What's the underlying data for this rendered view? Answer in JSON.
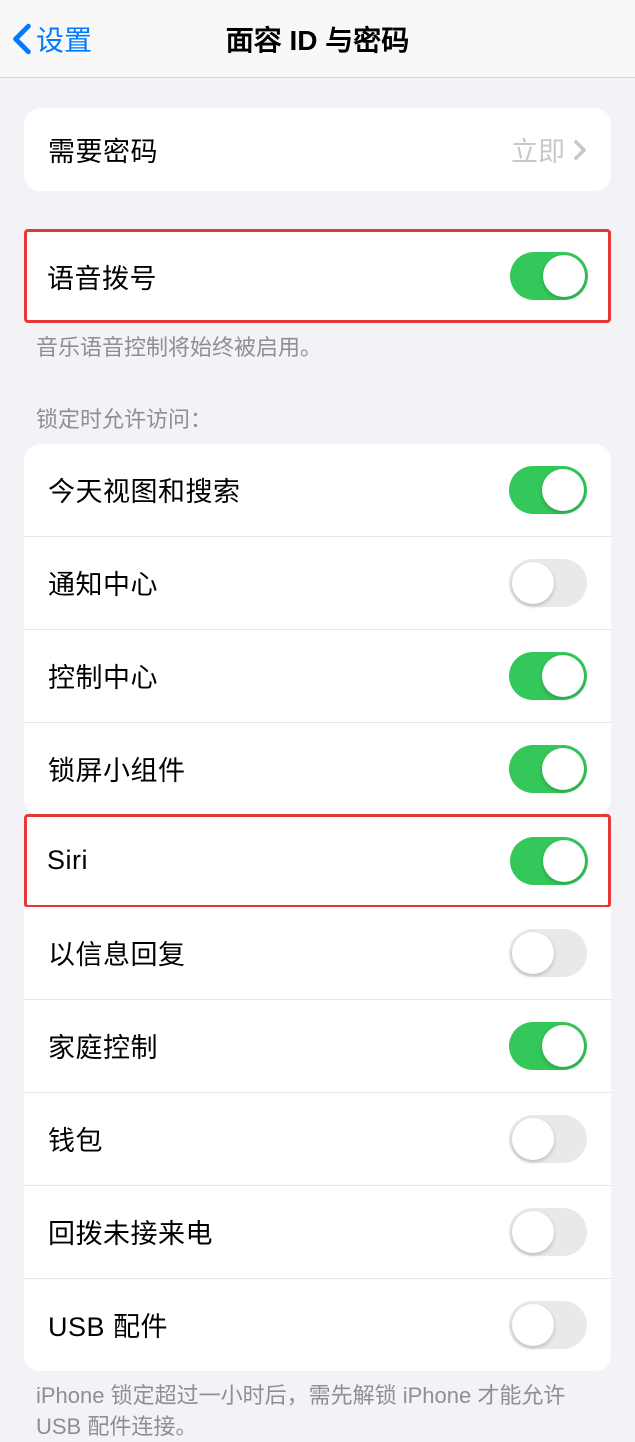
{
  "nav": {
    "back_label": "设置",
    "title": "面容 ID 与密码"
  },
  "require_passcode": {
    "label": "需要密码",
    "value": "立即"
  },
  "voice_dial": {
    "label": "语音拨号",
    "on": true,
    "footer": "音乐语音控制将始终被启用。"
  },
  "allow_access_header": "锁定时允许访问：",
  "allow_access": {
    "today_view": {
      "label": "今天视图和搜索",
      "on": true
    },
    "notification_center": {
      "label": "通知中心",
      "on": false
    },
    "control_center": {
      "label": "控制中心",
      "on": true
    },
    "lock_widgets": {
      "label": "锁屏小组件",
      "on": true
    },
    "siri": {
      "label": "Siri",
      "on": true
    },
    "reply_message": {
      "label": "以信息回复",
      "on": false
    },
    "home_control": {
      "label": "家庭控制",
      "on": true
    },
    "wallet": {
      "label": "钱包",
      "on": false
    },
    "return_calls": {
      "label": "回拨未接来电",
      "on": false
    },
    "usb": {
      "label": "USB 配件",
      "on": false
    }
  },
  "usb_footer": "iPhone 锁定超过一小时后，需先解锁 iPhone 才能允许 USB 配件连接。"
}
